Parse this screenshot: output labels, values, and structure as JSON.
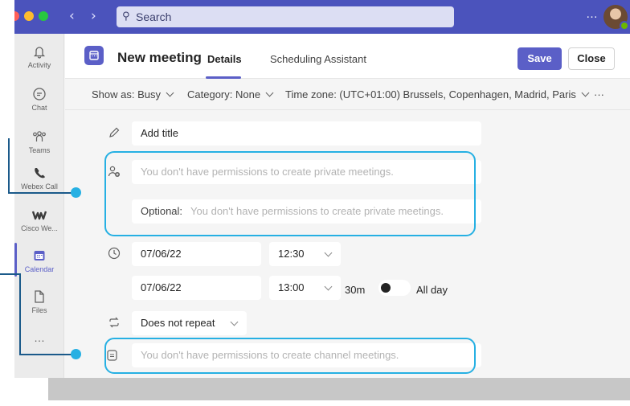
{
  "titlebar": {
    "search_placeholder": "Search",
    "more_label": "…",
    "colors": {
      "bar": "#4b53bc",
      "accent": "#5b5fc7"
    }
  },
  "rail": {
    "items": [
      {
        "label": "Activity",
        "icon": "bell-icon"
      },
      {
        "label": "Chat",
        "icon": "chat-icon"
      },
      {
        "label": "Teams",
        "icon": "teams-icon"
      },
      {
        "label": "Webex Call",
        "icon": "webex-call-icon"
      },
      {
        "label": "Cisco We...",
        "icon": "cisco-webex-icon"
      },
      {
        "label": "Calendar",
        "icon": "calendar-icon",
        "active": true
      },
      {
        "label": "Files",
        "icon": "file-icon"
      }
    ],
    "more_label": "…"
  },
  "header": {
    "title": "New meeting",
    "tabs": [
      "Details",
      "Scheduling Assistant"
    ],
    "active_tab": "Details",
    "save_label": "Save",
    "close_label": "Close"
  },
  "options": {
    "show_as": "Show as: Busy",
    "category": "Category: None",
    "time_zone": "Time zone: (UTC+01:00) Brussels, Copenhagen, Madrid, Paris",
    "more_label": "···"
  },
  "form": {
    "title_placeholder": "Add title",
    "attendees_placeholder": "You don't have permissions to create private meetings.",
    "optional_label": "Optional:",
    "optional_placeholder": "You don't have permissions to create private meetings.",
    "start_date": "07/06/22",
    "start_time": "12:30",
    "end_date": "07/06/22",
    "end_time": "13:00",
    "duration": "30m",
    "all_day_label": "All day",
    "all_day_on": false,
    "repeat": "Does not repeat",
    "channel_placeholder": "You don't have permissions to create channel meetings."
  }
}
